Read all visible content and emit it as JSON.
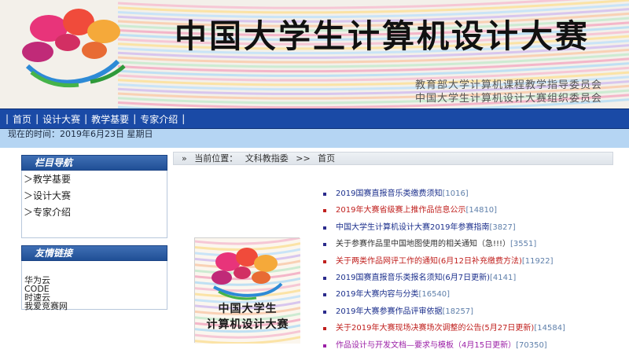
{
  "header": {
    "title": "中国大学生计算机设计大赛",
    "org_line_1": "教育部大学计算机课程教学指导委员会",
    "org_line_2": "中国大学生计算机设计大赛组织委员会",
    "logo_icon": "flower-logo-icon"
  },
  "nav": {
    "separator": "|",
    "items": [
      {
        "label": "首页"
      },
      {
        "label": "设计大赛"
      },
      {
        "label": "教学基要"
      },
      {
        "label": "专家介绍"
      }
    ],
    "bar_color": "#1a4aa6"
  },
  "date_text": "现在的时间：2019年6月23日  星期日",
  "sidebar": {
    "nav_title": "栏目导航",
    "nav_items": [
      {
        "label": "＞教学基要"
      },
      {
        "label": "＞设计大赛"
      },
      {
        "label": "＞专家介绍"
      }
    ],
    "friends_title": "友情链接",
    "friend_links": [
      {
        "label": "华为云"
      },
      {
        "label": "CODE"
      },
      {
        "label": "时速云"
      },
      {
        "label": "我爱竞赛网"
      }
    ]
  },
  "breadcrumb": {
    "marker": "»",
    "label": "当前位置：",
    "parts": [
      "文科教指委",
      ">>",
      "首页"
    ]
  },
  "promo": {
    "line_1": "中国大学生",
    "line_2": "计算机设计大赛"
  },
  "news": [
    {
      "title": "2019国赛直报音乐类缴费须知",
      "count": "[1016]",
      "color": "#1b2f8c",
      "bullet": "#2b2b8c"
    },
    {
      "title": "2019年大赛省级赛上推作品信息公示",
      "count": "[14810]",
      "color": "#c0201e",
      "bullet": "#c0201e"
    },
    {
      "title": "中国大学生计算机设计大赛2019年参赛指南",
      "count": "[3827]",
      "color": "#1b2f8c",
      "bullet": "#2b2b8c"
    },
    {
      "title": "关于参赛作品里中国地图使用的相关通知（急!!!）",
      "count": "[3551]",
      "color": "#333333",
      "bullet": "#2b2b8c"
    },
    {
      "title": "关于两类作品网评工作的通知(6月12日补充缴费方法)",
      "count": "[11922]",
      "color": "#c0201e",
      "bullet": "#c0201e"
    },
    {
      "title": "2019国赛直报音乐类报名须知(6月7日更新)",
      "count": "[4141]",
      "color": "#1b2f8c",
      "bullet": "#2b2b8c"
    },
    {
      "title": "2019年大赛内容与分类",
      "count": "[16540]",
      "color": "#1b2f8c",
      "bullet": "#2b2b8c"
    },
    {
      "title": "2019年大赛参赛作品评审依据",
      "count": "[18257]",
      "color": "#1b2f8c",
      "bullet": "#2b2b8c"
    },
    {
      "title": "关于2019年大赛现场决赛场次调整的公告(5月27日更新)",
      "count": "[14584]",
      "color": "#c0201e",
      "bullet": "#c0201e"
    },
    {
      "title": "作品设计与开发文档—要求与模板（4月15日更新）",
      "count": "[70350]",
      "color": "#9b1fa6",
      "bullet": "#9b1fa6"
    }
  ]
}
